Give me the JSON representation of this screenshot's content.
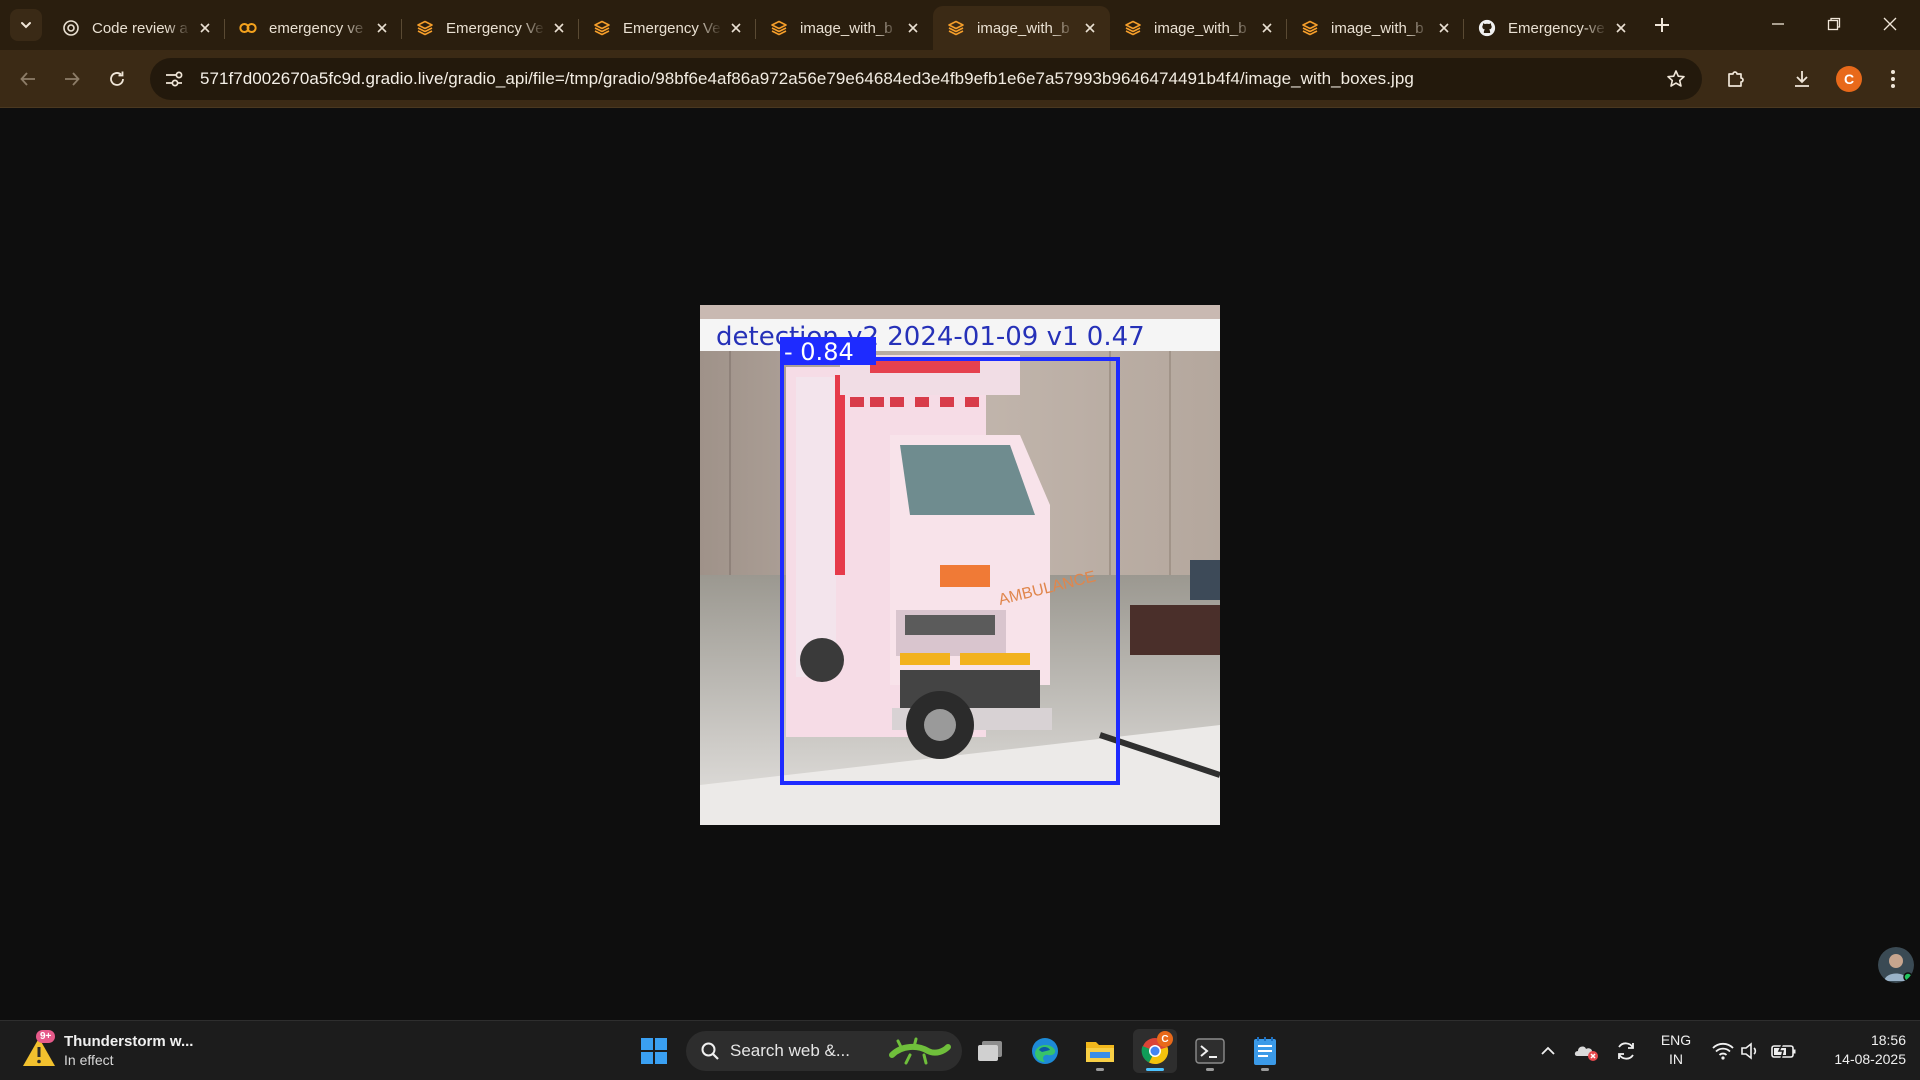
{
  "browser": {
    "tabs": [
      {
        "title": "Code review a",
        "favicon": "openai-icon",
        "active": false
      },
      {
        "title": "emergency ve",
        "favicon": "colab-icon",
        "active": false
      },
      {
        "title": "Emergency Ve",
        "favicon": "gradio-icon",
        "active": false
      },
      {
        "title": "Emergency Ve",
        "favicon": "gradio-icon",
        "active": false
      },
      {
        "title": "image_with_b",
        "favicon": "gradio-icon",
        "active": false
      },
      {
        "title": "image_with_b",
        "favicon": "gradio-icon",
        "active": true
      },
      {
        "title": "image_with_b",
        "favicon": "gradio-icon",
        "active": false
      },
      {
        "title": "image_with_b",
        "favicon": "gradio-icon",
        "active": false
      },
      {
        "title": "Emergency-ve",
        "favicon": "github-icon",
        "active": false
      }
    ],
    "url_host": "571f7d002670a5fc9d.gradio.live",
    "url_path": "/gradio_api/file=/tmp/gradio/98bf6e4af86a972a56e79e64684ed3e4fb9efb1e6e7a57993b9646474491b4f4/image_with_boxes.jpg",
    "profile_initial": "C"
  },
  "image": {
    "header_text": "detection v2 2024-01-09 v1 0.47",
    "box_label": "- 0.84",
    "box_color": "#1e2bff",
    "vehicle_text": "AMBULANCE"
  },
  "taskbar": {
    "weather_badge": "9+",
    "weather_title": "Thunderstorm w...",
    "weather_subtitle": "In effect",
    "search_placeholder": "Search web &...",
    "lang_line1": "ENG",
    "lang_line2": "IN",
    "time": "18:56",
    "date": "14-08-2025",
    "chrome_badge": "C"
  }
}
